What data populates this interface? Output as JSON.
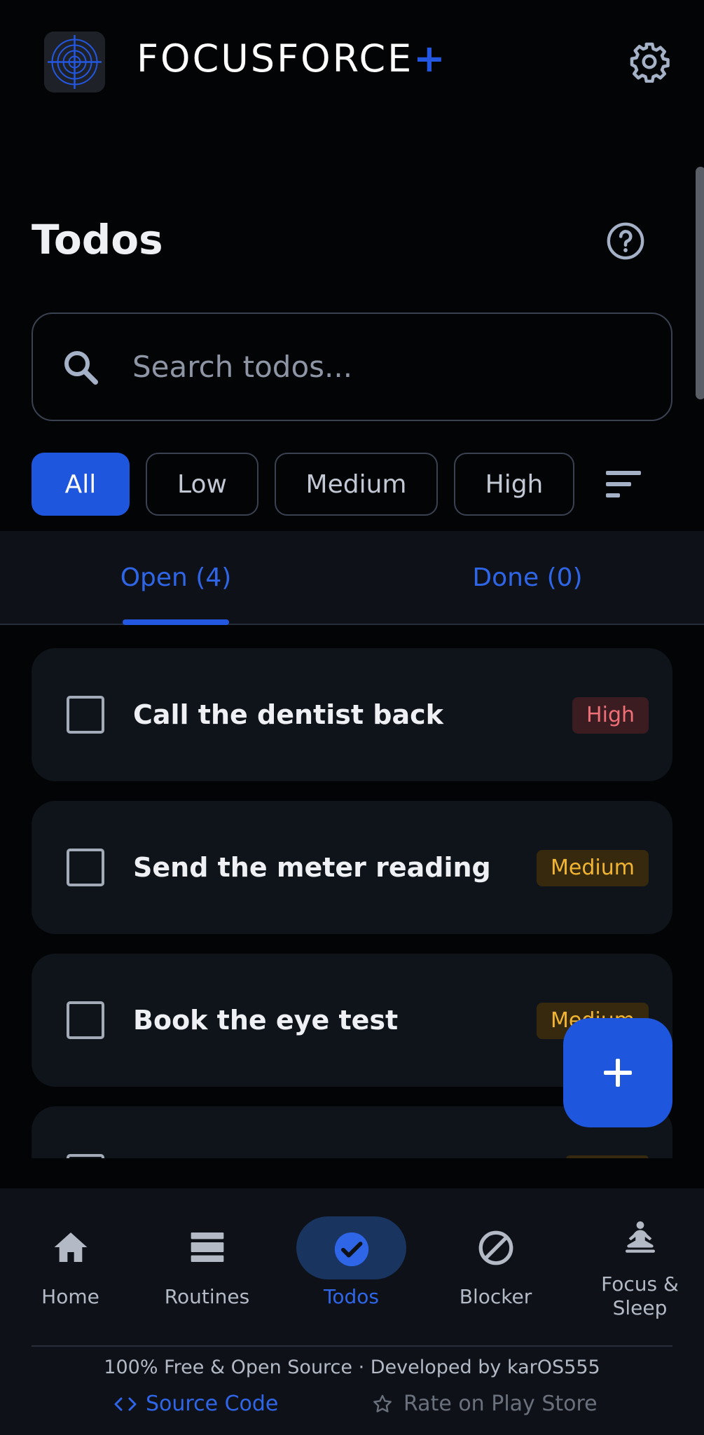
{
  "app": {
    "brand_name": "FOCUSFORCE",
    "brand_plus": "+",
    "accent_color": "#2457e0",
    "logo_icon": "target-icon",
    "settings_icon": "gear-icon"
  },
  "header": {
    "title": "Todos",
    "help_icon": "help-circle-icon"
  },
  "search": {
    "placeholder": "Search todos...",
    "value": "",
    "icon": "search-icon"
  },
  "filters": {
    "chips": [
      {
        "label": "All",
        "active": true
      },
      {
        "label": "Low",
        "active": false
      },
      {
        "label": "Medium",
        "active": false
      },
      {
        "label": "High",
        "active": false
      }
    ],
    "sort_icon": "sort-icon"
  },
  "tabs": [
    {
      "label": "Open (4)",
      "selected": true
    },
    {
      "label": "Done (0)",
      "selected": false
    }
  ],
  "todos": [
    {
      "text": "Call the dentist back",
      "priority": "High",
      "checked": false
    },
    {
      "text": "Send the meter reading",
      "priority": "Medium",
      "checked": false
    },
    {
      "text": "Book the eye test",
      "priority": "Medium",
      "checked": false
    },
    {
      "text": "",
      "priority": "",
      "checked": false
    }
  ],
  "fab": {
    "icon": "plus-icon"
  },
  "bottom_nav": [
    {
      "label": "Home",
      "icon": "home-icon",
      "selected": false
    },
    {
      "label": "Routines",
      "icon": "routines-icon",
      "selected": false
    },
    {
      "label": "Todos",
      "icon": "check-circle-icon",
      "selected": true
    },
    {
      "label": "Blocker",
      "icon": "block-icon",
      "selected": false
    },
    {
      "label": "Focus &\nSleep",
      "icon": "meditation-icon",
      "selected": false
    }
  ],
  "footer": {
    "text": "100% Free & Open Source · Developed by karOS555",
    "source_code": "Source Code",
    "rate": "Rate on Play Store"
  },
  "colors": {
    "background": "#030405",
    "card": "#0f141b",
    "priority_high": "#f07078",
    "priority_medium": "#f2b531"
  }
}
